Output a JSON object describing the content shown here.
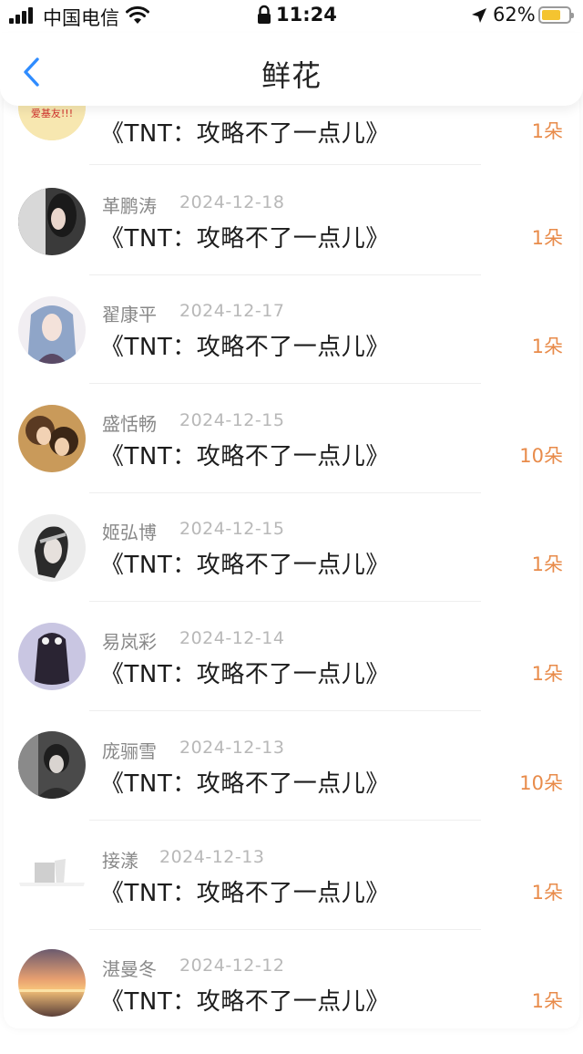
{
  "status_bar": {
    "carrier": "中国电信",
    "time": "11:24",
    "battery_percent": "62%",
    "battery_level": 0.62,
    "battery_color": "#f4c430"
  },
  "header": {
    "title": "鲜花",
    "back_icon": "chevron-left-icon",
    "accent_color": "#2f8cff"
  },
  "records": [
    {
      "name": "",
      "date": "",
      "book": "《TNT：攻略不了一点儿》",
      "flowers": "1朵",
      "avatar_text": "爱基友!!!"
    },
    {
      "name": "革鹏涛",
      "date": "2024-12-18",
      "book": "《TNT：攻略不了一点儿》",
      "flowers": "1朵"
    },
    {
      "name": "翟康平",
      "date": "2024-12-17",
      "book": "《TNT：攻略不了一点儿》",
      "flowers": "1朵"
    },
    {
      "name": "盛恬畅",
      "date": "2024-12-15",
      "book": "《TNT：攻略不了一点儿》",
      "flowers": "10朵"
    },
    {
      "name": "姬弘博",
      "date": "2024-12-15",
      "book": "《TNT：攻略不了一点儿》",
      "flowers": "1朵"
    },
    {
      "name": "易岚彩",
      "date": "2024-12-14",
      "book": "《TNT：攻略不了一点儿》",
      "flowers": "1朵"
    },
    {
      "name": "庞骊雪",
      "date": "2024-12-13",
      "book": "《TNT：攻略不了一点儿》",
      "flowers": "10朵"
    },
    {
      "name": "接漾",
      "date": "2024-12-13",
      "book": "《TNT：攻略不了一点儿》",
      "flowers": "1朵"
    },
    {
      "name": "湛曼冬",
      "date": "2024-12-12",
      "book": "《TNT：攻略不了一点儿》",
      "flowers": "1朵"
    }
  ],
  "colors": {
    "flower_count": "#e88b4a",
    "name": "#888888",
    "date": "#b8b8b8"
  }
}
